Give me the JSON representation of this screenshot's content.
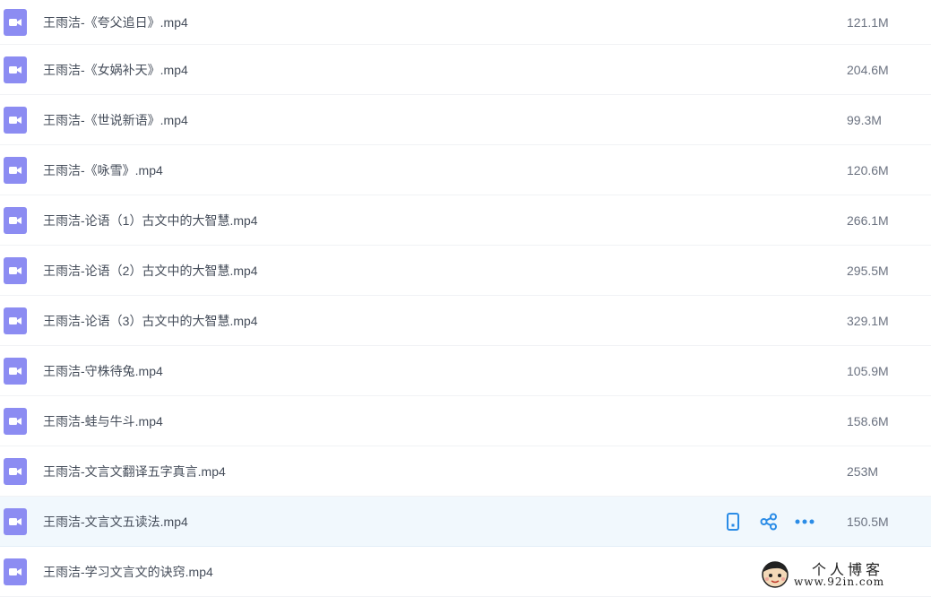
{
  "colors": {
    "video_icon": "#8c8cf2",
    "action_icon": "#2b8ce6",
    "hover_row": "#f1f8fd"
  },
  "files": [
    {
      "name": "王雨洁-《夸父追日》.mp4",
      "size": "121.1M",
      "icon": "video-file-icon"
    },
    {
      "name": "王雨洁-《女娲补天》.mp4",
      "size": "204.6M",
      "icon": "video-file-icon"
    },
    {
      "name": "王雨洁-《世说新语》.mp4",
      "size": "99.3M",
      "icon": "video-file-icon"
    },
    {
      "name": "王雨洁-《咏雪》.mp4",
      "size": "120.6M",
      "icon": "video-file-icon"
    },
    {
      "name": "王雨洁-论语（1）古文中的大智慧.mp4",
      "size": "266.1M",
      "icon": "video-file-icon"
    },
    {
      "name": "王雨洁-论语（2）古文中的大智慧.mp4",
      "size": "295.5M",
      "icon": "video-file-icon"
    },
    {
      "name": "王雨洁-论语（3）古文中的大智慧.mp4",
      "size": "329.1M",
      "icon": "video-file-icon"
    },
    {
      "name": "王雨洁-守株待兔.mp4",
      "size": "105.9M",
      "icon": "video-file-icon"
    },
    {
      "name": "王雨洁-蛙与牛斗.mp4",
      "size": "158.6M",
      "icon": "video-file-icon"
    },
    {
      "name": "王雨洁-文言文翻译五字真言.mp4",
      "size": "253M",
      "icon": "video-file-icon"
    },
    {
      "name": "王雨洁-文言文五读法.mp4",
      "size": "150.5M",
      "icon": "video-file-icon"
    },
    {
      "name": "王雨洁-学习文言文的诀窍.mp4",
      "size": "",
      "icon": "video-file-icon"
    }
  ],
  "hover_actions": [
    "phone-icon",
    "share-icon",
    "more-icon"
  ],
  "watermark": {
    "title": "个人博客",
    "url": "www.92in.com"
  }
}
